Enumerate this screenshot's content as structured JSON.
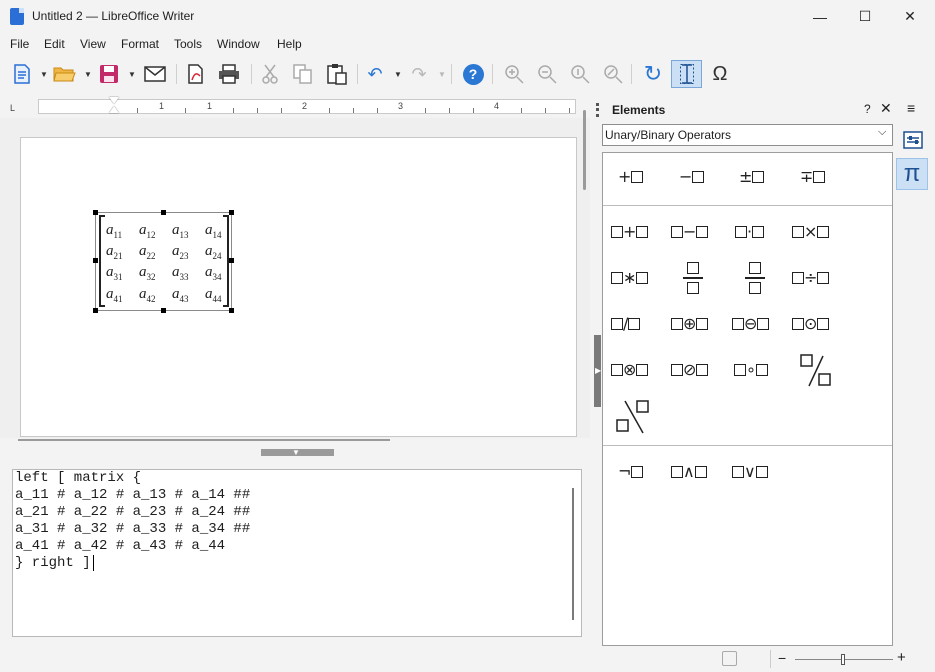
{
  "window": {
    "title": "Untitled 2 — LibreOffice Writer",
    "minimize": "—",
    "maximize": "☐",
    "close": "✕"
  },
  "menu": [
    "File",
    "Edit",
    "View",
    "Format",
    "Tools",
    "Window",
    "Help"
  ],
  "toolbar": {
    "icons": [
      "new-icon",
      "open-icon",
      "save-icon",
      "email-icon",
      "export-pdf-icon",
      "print-icon",
      "cut-icon",
      "copy-icon",
      "paste-icon",
      "undo-icon",
      "redo-icon",
      "help-icon",
      "zoom-in-icon",
      "zoom-out-icon",
      "zoom-100-icon",
      "show-all-icon",
      "update-icon",
      "formula-cursor-icon",
      "symbols-icon"
    ],
    "help_glyph": "?",
    "symbols_glyph": "Ω",
    "update_glyph": "↻",
    "undo_glyph": "↶",
    "redo_glyph": "↷"
  },
  "ruler": {
    "corner": "L",
    "numbers": [
      "1",
      "1",
      "2",
      "3",
      "4"
    ]
  },
  "formula_matrix": [
    [
      [
        "a",
        "11"
      ],
      [
        "a",
        "12"
      ],
      [
        "a",
        "13"
      ],
      [
        "a",
        "14"
      ]
    ],
    [
      [
        "a",
        "21"
      ],
      [
        "a",
        "22"
      ],
      [
        "a",
        "23"
      ],
      [
        "a",
        "24"
      ]
    ],
    [
      [
        "a",
        "31"
      ],
      [
        "a",
        "32"
      ],
      [
        "a",
        "33"
      ],
      [
        "a",
        "34"
      ]
    ],
    [
      [
        "a",
        "41"
      ],
      [
        "a",
        "42"
      ],
      [
        "a",
        "43"
      ],
      [
        "a",
        "44"
      ]
    ]
  ],
  "command_editor": {
    "lines": [
      "left [ matrix {",
      "a_11 # a_12 # a_13 # a_14 ##",
      "a_21 # a_22 # a_23 # a_24 ##",
      "a_31 # a_32 # a_33 # a_34 ##",
      "a_41 # a_42 # a_43 # a_44",
      "} right ]"
    ]
  },
  "sidebar": {
    "title": "Elements",
    "help": "?",
    "close": "✕",
    "menu": "≡",
    "category": "Unary/Binary Operators",
    "deck_icons": [
      "properties-icon",
      "elements-pi-icon"
    ],
    "pi_glyph": "π",
    "unary_ops": [
      "+",
      "−",
      "±",
      "∓"
    ],
    "binary_ops_row1": [
      "+",
      "−",
      "·",
      "×"
    ],
    "binary_ops_row3": [
      "/",
      "⊕",
      "⊖",
      "⊙"
    ],
    "binary_ops_row4": [
      "⊗",
      "⊘",
      "∘"
    ],
    "binary_times_star": "∗",
    "binary_div": "÷",
    "logic_ops": [
      "¬",
      "∧",
      "∨"
    ]
  },
  "statusbar": {
    "zoom_minus": "−",
    "zoom_plus": "+"
  }
}
